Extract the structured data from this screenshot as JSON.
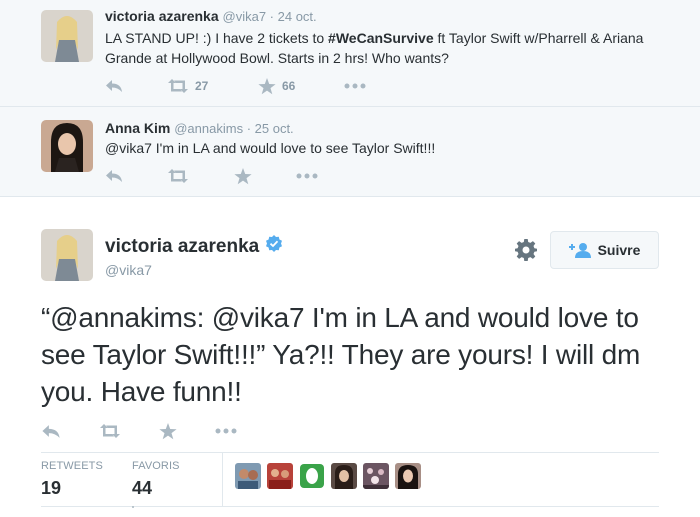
{
  "tweets": [
    {
      "fullname": "victoria azarenka",
      "handle": "@vika7",
      "sep": " · ",
      "date": "24 oct.",
      "text_before": "LA STAND UP! :) I have 2 tickets to ",
      "hashtag": "#WeCanSurvive",
      "text_after": " ft Taylor Swift w/Pharrell & Ariana Grande at Hollywood Bowl. Starts in 2 hrs! Who wants?",
      "retweets": "27",
      "favorites": "66"
    },
    {
      "fullname": "Anna Kim",
      "handle": "@annakims",
      "sep": " · ",
      "date": "25 oct.",
      "text": "@vika7 I'm in LA and would love to see Taylor Swift!!!"
    }
  ],
  "main": {
    "fullname": "victoria azarenka",
    "handle": "@vika7",
    "follow_label": "Suivre",
    "text": "“@annakims: @vika7 I'm in LA and would love to see Taylor Swift!!!” Ya?!! They are yours! I will dm you. Have funn!!",
    "stats": {
      "retweets_label": "RETWEETS",
      "retweets_value": "19",
      "favorites_label": "FAVORIS",
      "favorites_value": "44"
    }
  },
  "icons": {
    "reply": "reply-icon",
    "retweet": "retweet-icon",
    "favorite": "star-icon",
    "more": "more-icon",
    "gear": "gear-icon",
    "follow": "add-user-icon",
    "verified": "verified-badge-icon"
  },
  "colors": {
    "accent": "#55acee",
    "icon_gray": "#aab8c2",
    "meta_gray": "#8899a6",
    "text": "#292f33"
  }
}
